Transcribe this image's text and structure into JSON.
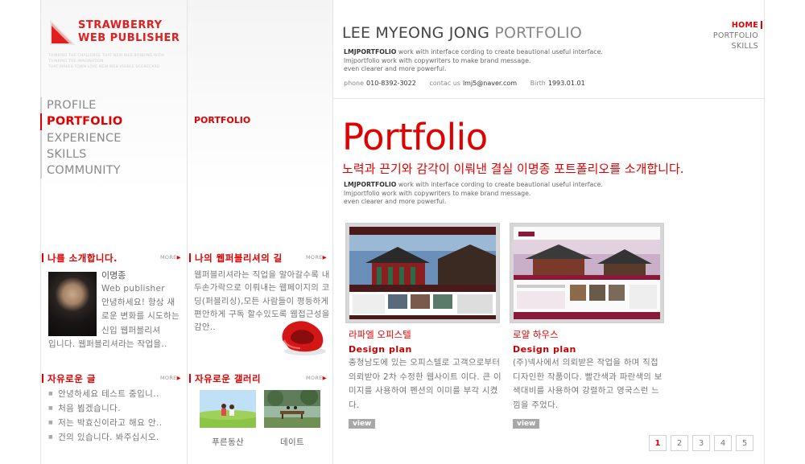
{
  "logo": {
    "line1": "STRAWBERRY",
    "line2": "WEB PUBLISHER",
    "sub1": "THINKING THE CHALLENGE THAT NEW WEB BONDING WITH",
    "sub2": "THINKING THE IMAGINATION",
    "sub3": "THAT MAKES TOWN LOVE NEW WEB VISIBLE SCORECARD"
  },
  "nav": [
    "PROFILE",
    "PORTFOLIO",
    "EXPERIENCE",
    "SKILLS",
    "COMMUNITY"
  ],
  "breadcrumb": "PORTFOLIO",
  "header": {
    "title_dark": "LEE MYEONG JONG",
    "title_light": "PORTFOLIO",
    "desc_brand": "LMJPORTFOLIO",
    "desc_line1": " work with interface cording to create beautional useful interface.",
    "desc_line2": "lmjportfolio work with copywriters to make brand message.",
    "desc_line3": "even clearer and more powerful.",
    "phone_label": "phone",
    "phone": "010-8392-3022",
    "contact_label": "contac us",
    "email": "lmj5@naver.com",
    "birth_label": "Birth",
    "birth": "1993.01.01"
  },
  "topnav": [
    "HOME",
    "PORTFOLIO",
    "SKILLS"
  ],
  "main": {
    "title": "Portfolio",
    "subtitle": "노력과 끈기와 감각이 이뤄낸 결실 이명종 포트폴리오를 소개합니다.",
    "desc_brand": "LMJPORTFOLIO",
    "desc_line1": " work with interface cording to create beautional useful interface.",
    "desc_line2": "lmjportfolio work with copywriters to make brand message.",
    "desc_line3": "even clearer and more powerful."
  },
  "cards": [
    {
      "title": "라파엘 오피스텔",
      "sub": "Design plan",
      "body": "충청남도에 있는 오피스텔로 고객으로부터 의뢰받아 2차 수정한 웹사이트 이다. 큰 이미지를 사용하여 펜션의 이미를 부각 시켰다.",
      "view": "view"
    },
    {
      "title": "로얄 하우스",
      "sub": "Design plan",
      "body": "(주)넥사에서 의뢰받은 작업을 하며 직접 디자인한 작품이다. 빨간색과 파란색의 보색대비를 사용하여 강렬하고 영국스런 느낌을 주었다.",
      "view": "view"
    }
  ],
  "pager": [
    "1",
    "2",
    "3",
    "4",
    "5"
  ],
  "intro": {
    "heading": "나를 소개합니다.",
    "more": "MORE",
    "name": "이명종",
    "line1": "Web publisher",
    "body": "안녕하세요! 항상 새로운 변화를 시도하는 신입 웹퍼블리셔",
    "tail": "입니다. 웹퍼블리셔라는 작업을.."
  },
  "road": {
    "heading": "나의 웹퍼블리셔의 길",
    "more": "MORE",
    "body": "웹퍼블리셔라는 직업을 알아갈수록 내두손가락으로 이뤄내는 웹페이지의 코딩(퍼블리싱),모든 사람들이 평등하게 편안하게 구독 할수있도록 웹접근성을 감안.."
  },
  "board": {
    "heading": "자유로운 글",
    "more": "MORE",
    "items": [
      "안녕하세요 테스트 중입니..",
      "처음 뵙겠습니다.",
      "저는 박효신이라고 해요 안..",
      "건의 있습니다. 봐주십시오."
    ]
  },
  "gallery": {
    "heading": "자유로운 갤러리",
    "more": "MORE",
    "items": [
      "푸른동산",
      "데이트"
    ]
  },
  "colors": {
    "accent": "#e00000",
    "text": "#777777",
    "border": "#e4e4e4"
  }
}
